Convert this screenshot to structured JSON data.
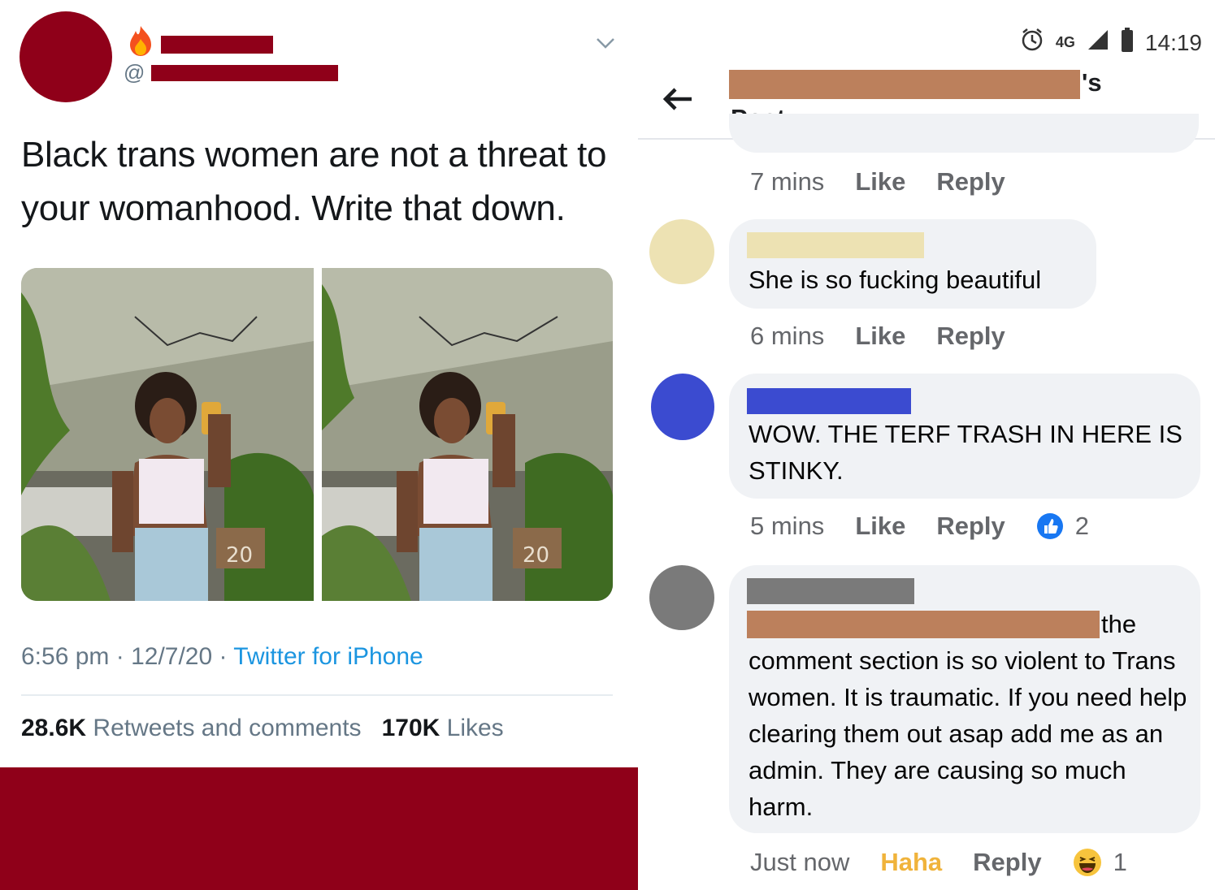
{
  "tweet": {
    "handle_prefix": "@",
    "text": "Black trans women are not a threat to your womanhood. Write that down.",
    "time": "6:56 pm",
    "sep1": " · ",
    "date": "12/7/20",
    "sep2": " · ",
    "source": "Twitter for iPhone",
    "retweets_count": "28.6K",
    "retweets_label": "Retweets and comments",
    "likes_count": "170K",
    "likes_label": "Likes",
    "photo_sign_text": "20",
    "colors": {
      "redaction": "#8f0019",
      "link": "#1b95e0",
      "muted": "#657786"
    }
  },
  "facebook": {
    "status_time": "14:19",
    "network": "4G",
    "header_suffix": "'s",
    "header_title": "Post",
    "comments": [
      {
        "time": "7 mins",
        "like": "Like",
        "reply": "Reply"
      },
      {
        "text": "She is so fucking beautiful",
        "time": "6 mins",
        "like": "Like",
        "reply": "Reply",
        "avatar_color": "#ede2b3"
      },
      {
        "text": "WOW. THE TERF TRASH IN HERE IS STINKY.",
        "time": "5 mins",
        "like": "Like",
        "reply": "Reply",
        "reaction_count": "2",
        "reaction_icon": "like-icon",
        "avatar_color": "#3b4bd0"
      },
      {
        "text_first_line_end": "the",
        "text": "comment section is so violent to Trans women. It is traumatic. If you need help clearing them out asap add me as an admin. They are causing so much harm.",
        "time": "Just now",
        "reaction_label": "Haha",
        "reply": "Reply",
        "reaction_count": "1",
        "reaction_icon": "haha-icon",
        "avatar_color": "#7a7a7a"
      }
    ],
    "colors": {
      "bubble": "#f0f2f5",
      "redaction_tan": "#bc805c",
      "haha": "#f0b33b",
      "like_blue": "#1877f2"
    }
  }
}
